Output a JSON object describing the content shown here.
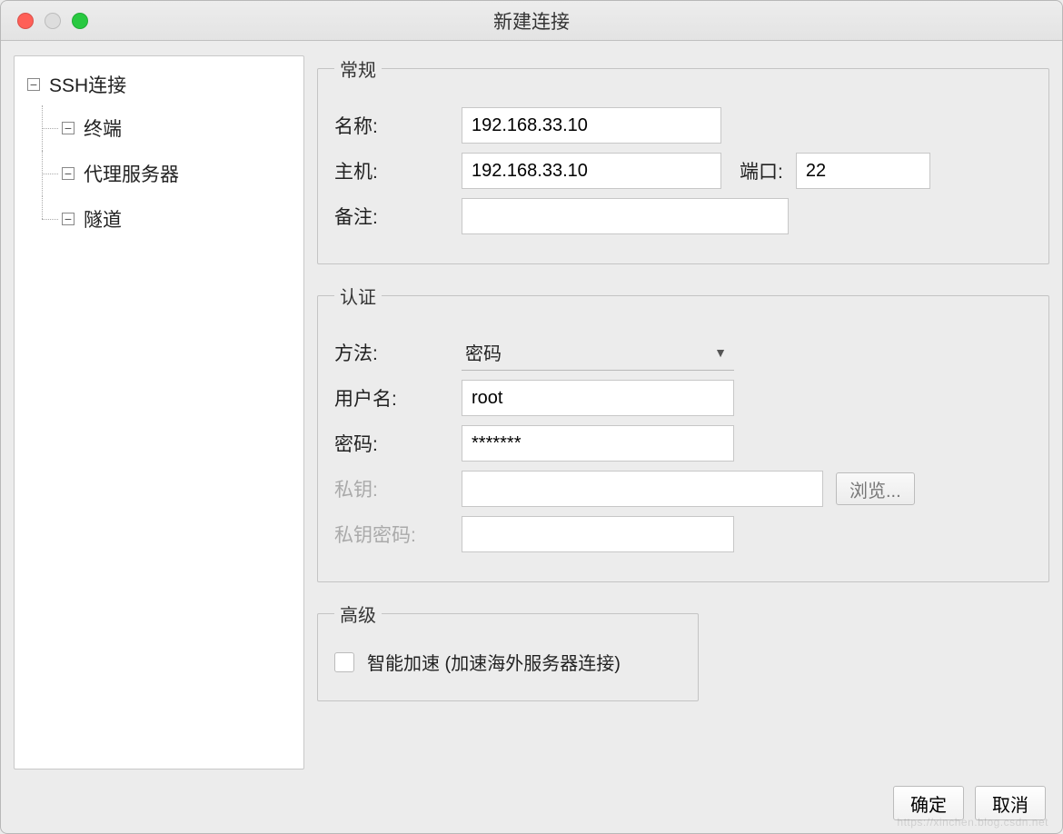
{
  "window": {
    "title": "新建连接"
  },
  "sidebar": {
    "root": "SSH连接",
    "items": [
      "终端",
      "代理服务器",
      "隧道"
    ]
  },
  "general": {
    "legend": "常规",
    "name_label": "名称:",
    "name_value": "192.168.33.10",
    "host_label": "主机:",
    "host_value": "192.168.33.10",
    "port_label": "端口:",
    "port_value": "22",
    "note_label": "备注:",
    "note_value": ""
  },
  "auth": {
    "legend": "认证",
    "method_label": "方法:",
    "method_value": "密码",
    "username_label": "用户名:",
    "username_value": "root",
    "password_label": "密码:",
    "password_value": "*******",
    "privkey_label": "私钥:",
    "privkey_value": "",
    "browse_label": "浏览...",
    "privkey_pass_label": "私钥密码:",
    "privkey_pass_value": ""
  },
  "advanced": {
    "legend": "高级",
    "smart_accel_label": "智能加速 (加速海外服务器连接)"
  },
  "footer": {
    "ok": "确定",
    "cancel": "取消"
  },
  "watermark": "https://xinchen.blog.csdn.net"
}
